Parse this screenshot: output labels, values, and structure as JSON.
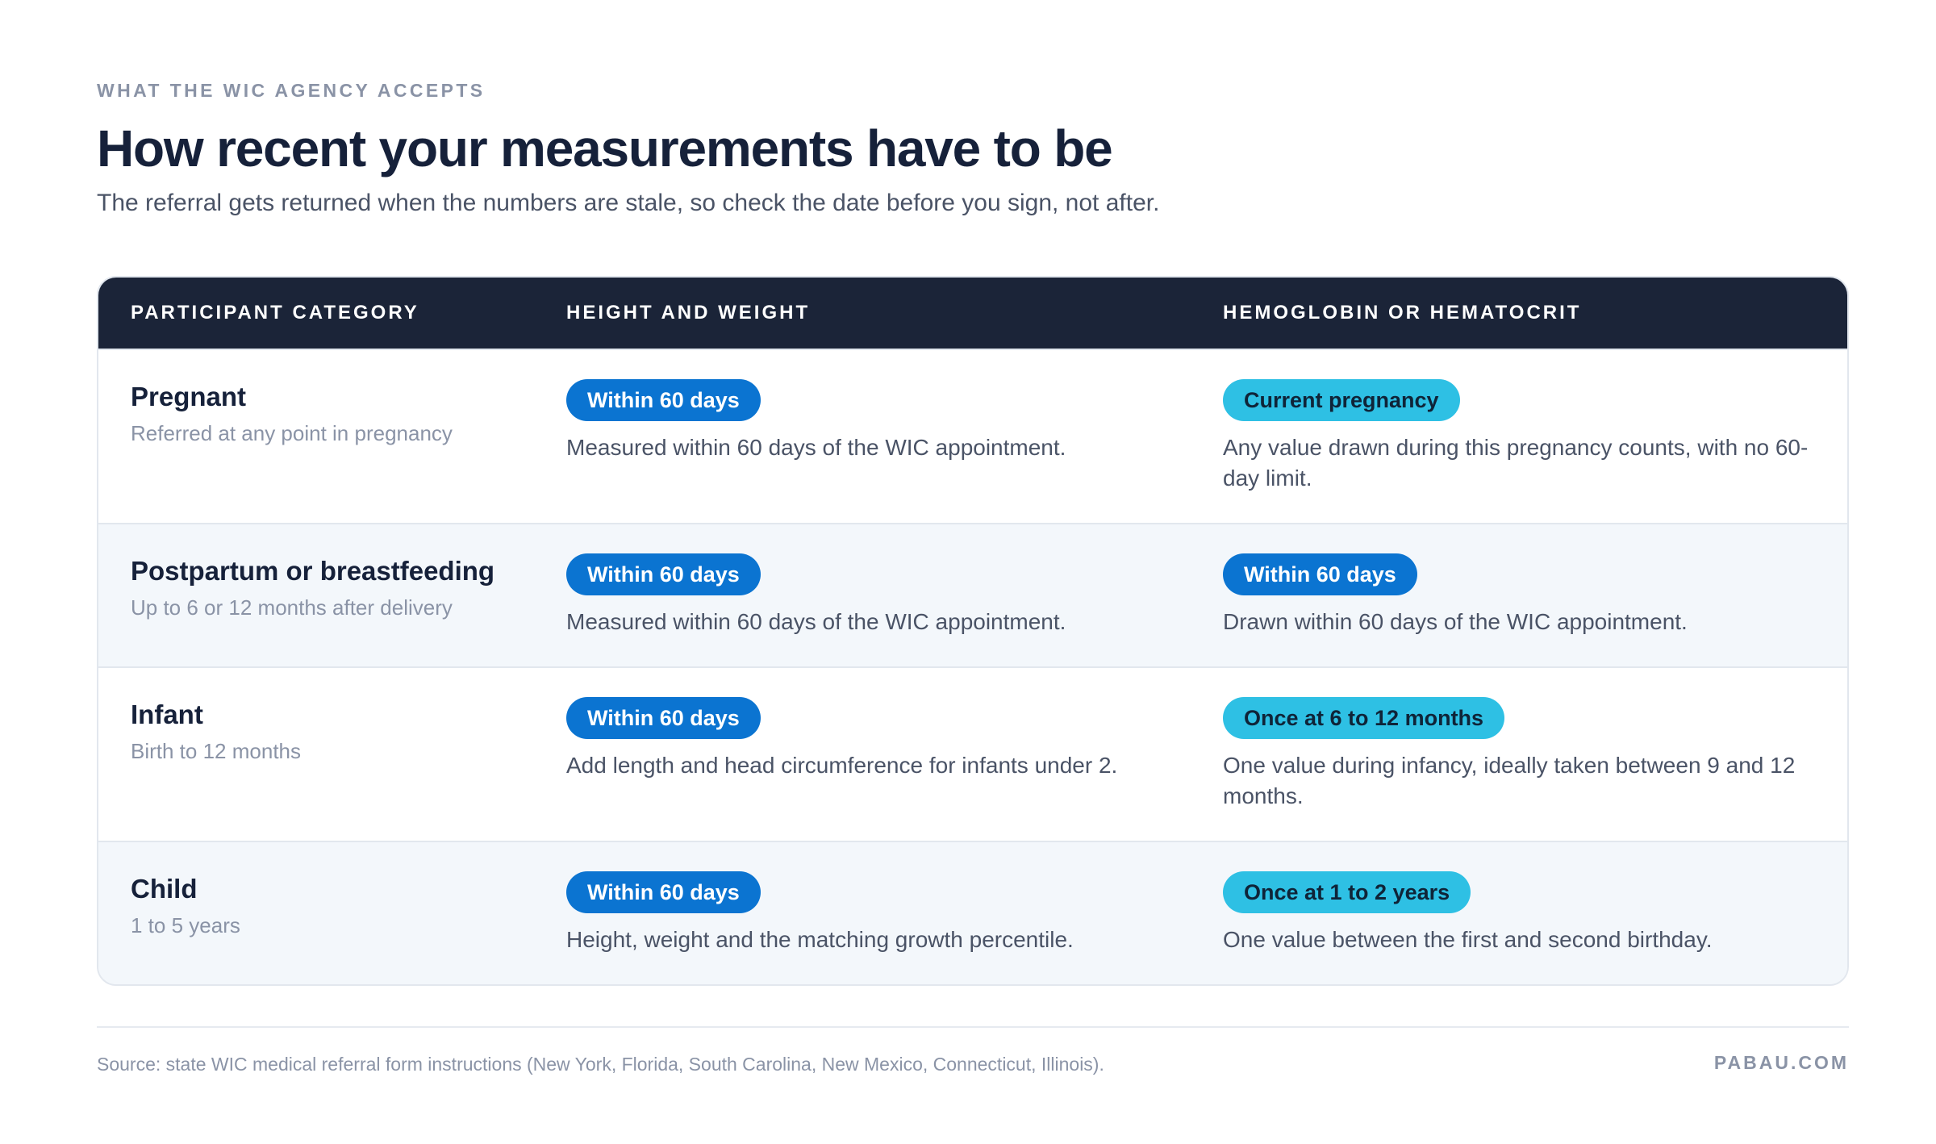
{
  "header": {
    "eyebrow": "WHAT THE WIC AGENCY ACCEPTS",
    "title": "How recent your measurements have to be",
    "subtitle": "The referral gets returned when the numbers are stale, so check the date before you sign, not after."
  },
  "table": {
    "columns": [
      "PARTICIPANT CATEGORY",
      "HEIGHT AND WEIGHT",
      "HEMOGLOBIN OR HEMATOCRIT"
    ],
    "rows": [
      {
        "category": "Pregnant",
        "category_sub": "Referred at any point in pregnancy",
        "hw_badge": "Within 60 days",
        "hw_desc": "Measured within 60 days of the WIC appointment.",
        "hb_badge": "Current pregnancy",
        "hb_desc": "Any value drawn during this pregnancy counts, with no 60-day limit."
      },
      {
        "category": "Postpartum or breastfeeding",
        "category_sub": "Up to 6 or 12 months after delivery",
        "hw_badge": "Within 60 days",
        "hw_desc": "Measured within 60 days of the WIC appointment.",
        "hb_badge": "Within 60 days",
        "hb_desc": "Drawn within 60 days of the WIC appointment."
      },
      {
        "category": "Infant",
        "category_sub": "Birth to 12 months",
        "hw_badge": "Within 60 days",
        "hw_desc": "Add length and head circumference for infants under 2.",
        "hb_badge": "Once at 6 to 12 months",
        "hb_desc": "One value during infancy, ideally taken between 9 and 12 months."
      },
      {
        "category": "Child",
        "category_sub": "1 to 5 years",
        "hw_badge": "Within 60 days",
        "hw_desc": "Height, weight and the matching growth percentile.",
        "hb_badge": "Once at 1 to 2 years",
        "hb_desc": "One value between the first and second birthday."
      }
    ]
  },
  "footer": {
    "source": "Source: state WIC medical referral form instructions (New York, Florida, South Carolina, New Mexico, Connecticut, Illinois).",
    "brand": "PABAU.COM"
  },
  "colors": {
    "header_bg": "#1b2438",
    "badge_blue": "#0b74d1",
    "badge_teal": "#2ec0e4",
    "row_alt": "#f3f7fb"
  }
}
